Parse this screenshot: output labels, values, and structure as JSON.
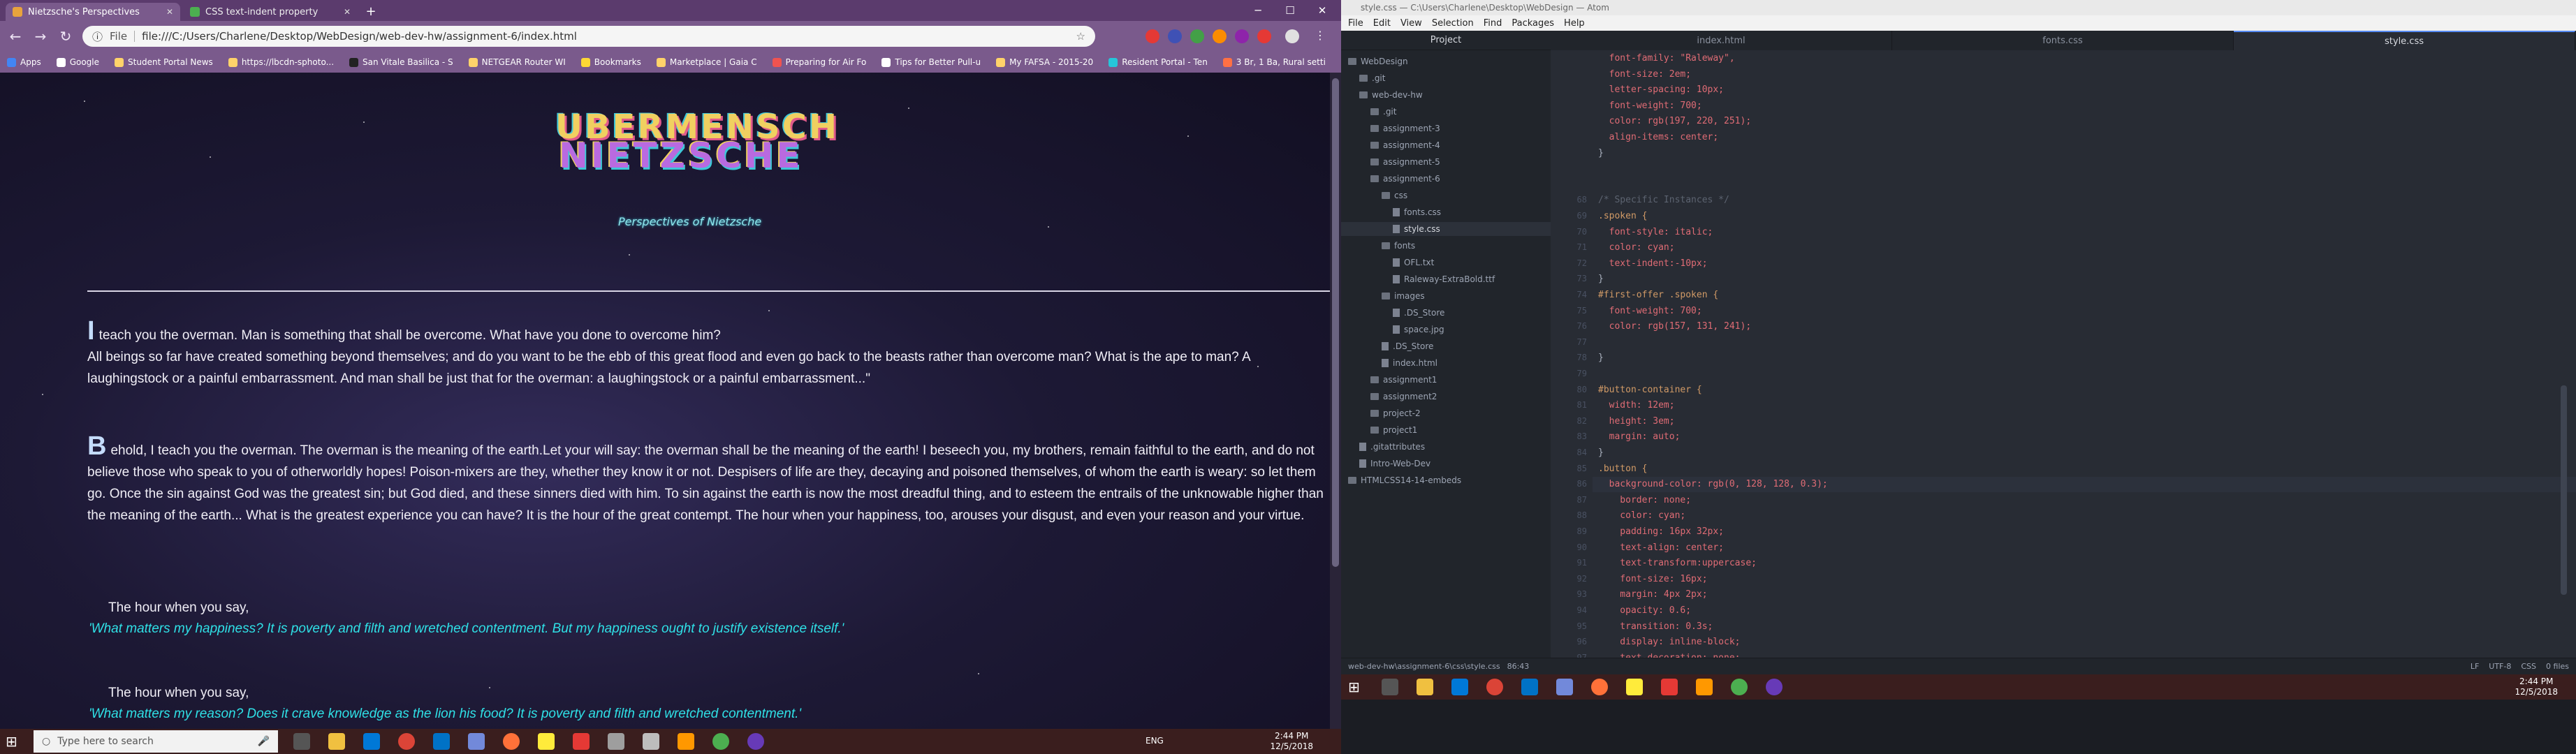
{
  "chrome": {
    "tabs": [
      {
        "label": "Nietzsche's Perspectives",
        "active": true
      },
      {
        "label": "CSS text-indent property",
        "active": false
      }
    ],
    "new_tab_icon": "plus-icon",
    "window_controls": [
      "minimize",
      "maximize",
      "close"
    ],
    "url_proto": "File",
    "url": "file:///C:/Users/Charlene/Desktop/WebDesign/web-dev-hw/assignment-6/index.html",
    "bookmarks": [
      "Apps",
      "Google",
      "Student Portal News",
      "https://lbcdn-sphoto...",
      "San Vitale Basilica - S",
      "NETGEAR Router WI",
      "Bookmarks",
      "Marketplace | Gaia C",
      "Preparing for Air Fo",
      "Tips for Better Pull-u",
      "My FAFSA - 2015-20",
      "Resident Portal - Ten",
      "3 Br, 1 Ba, Rural setti"
    ]
  },
  "page": {
    "title_line1": "UBERMENSCH",
    "title_line2": "NIETZSCHE",
    "subtitle": "Perspectives of Nietzsche",
    "p1_dropcap": "I",
    "p1_line1": "teach you the overman. Man is something that shall be overcome. What have you done to overcome him?",
    "p1_rest": "All beings so far have created something beyond themselves; and do you want to be the ebb of this great flood and even go back to the beasts rather than overcome man? What is the ape to man? A laughingstock or a painful embarrassment. And man shall be just that for the overman: a laughingstock or a painful embarrassment...\"",
    "p2_dropcap": "B",
    "p2_text": "ehold, I teach you the overman. The overman is the meaning of the earth.Let your will say: the overman shall be the meaning of the earth! I beseech you, my brothers, remain faithful to the earth, and do not believe those who speak to you of otherworldly hopes! Poison-mixers are they, whether they know it or not. Despisers of life are they, decaying and poisoned themselves, of whom the earth is weary: so let them go. Once the sin against God was the greatest sin; but God died, and these sinners died with him. To sin against the earth is now the most dreadful thing, and to esteem the entrails of the unknowable higher than the meaning of the earth... What is the greatest experience you can have? It is the hour of the great contempt. The hour when your happiness, too, arouses your disgust, and even your reason and your virtue.",
    "hour1": "The hour when you say,",
    "spoken1": "'What matters my happiness? It is poverty and filth and wretched contentment. But my happiness ought to justify existence itself.'",
    "hour2": "The hour when you say,",
    "spoken2": "'What matters my reason? Does it crave knowledge as the lion his food? It is poverty and filth and wretched contentment.'"
  },
  "taskbar_left": {
    "search_placeholder": "Type here to search",
    "time": "2:44 PM",
    "date": "12/5/2018",
    "lang": "ENG"
  },
  "atom": {
    "title": "style.css — C:\\Users\\Charlene\\Desktop\\WebDesign — Atom",
    "menu": [
      "File",
      "Edit",
      "View",
      "Selection",
      "Find",
      "Packages",
      "Help"
    ],
    "tree_header": "Project",
    "tree": [
      {
        "label": "WebDesign",
        "type": "folder",
        "depth": 0
      },
      {
        "label": ".git",
        "type": "folder",
        "depth": 1
      },
      {
        "label": "web-dev-hw",
        "type": "folder",
        "depth": 1
      },
      {
        "label": ".git",
        "type": "folder",
        "depth": 2
      },
      {
        "label": "assignment-3",
        "type": "folder",
        "depth": 2
      },
      {
        "label": "assignment-4",
        "type": "folder",
        "depth": 2
      },
      {
        "label": "assignment-5",
        "type": "folder",
        "depth": 2
      },
      {
        "label": "assignment-6",
        "type": "folder",
        "depth": 2
      },
      {
        "label": "css",
        "type": "folder",
        "depth": 3
      },
      {
        "label": "fonts.css",
        "type": "file",
        "depth": 4
      },
      {
        "label": "style.css",
        "type": "file",
        "depth": 4,
        "selected": true
      },
      {
        "label": "fonts",
        "type": "folder",
        "depth": 3
      },
      {
        "label": "OFL.txt",
        "type": "file",
        "depth": 4
      },
      {
        "label": "Raleway-ExtraBold.ttf",
        "type": "file",
        "depth": 4
      },
      {
        "label": "images",
        "type": "folder",
        "depth": 3
      },
      {
        "label": ".DS_Store",
        "type": "file",
        "depth": 4
      },
      {
        "label": "space.jpg",
        "type": "file",
        "depth": 4
      },
      {
        "label": ".DS_Store",
        "type": "file",
        "depth": 3
      },
      {
        "label": "index.html",
        "type": "file",
        "depth": 3
      },
      {
        "label": "assignment1",
        "type": "folder",
        "depth": 2
      },
      {
        "label": "assignment2",
        "type": "folder",
        "depth": 2
      },
      {
        "label": "project-2",
        "type": "folder",
        "depth": 2
      },
      {
        "label": "project1",
        "type": "folder",
        "depth": 2
      },
      {
        "label": ".gitattributes",
        "type": "file",
        "depth": 1
      },
      {
        "label": "Intro-Web-Dev",
        "type": "file",
        "depth": 1
      },
      {
        "label": "HTMLCSS14-14-embeds",
        "type": "folder",
        "depth": 0
      }
    ],
    "editor_tabs": [
      {
        "label": "index.html",
        "active": false
      },
      {
        "label": "fonts.css",
        "active": false
      },
      {
        "label": "style.css",
        "active": true
      }
    ],
    "lines": [
      {
        "n": "",
        "t": "  font-family: \"Raleway\","
      },
      {
        "n": "",
        "t": "  font-size: 2em;"
      },
      {
        "n": "",
        "t": "  letter-spacing: 10px;"
      },
      {
        "n": "",
        "t": "  font-weight: 700;"
      },
      {
        "n": "",
        "t": "  color: rgb(197, 220, 251);"
      },
      {
        "n": "",
        "t": "  align-items: center;"
      },
      {
        "n": "",
        "t": "}"
      },
      {
        "n": "",
        "t": ""
      },
      {
        "n": "",
        "t": ""
      },
      {
        "n": "68",
        "t": "/* Specific Instances */"
      },
      {
        "n": "69",
        "t": ".spoken {"
      },
      {
        "n": "70",
        "t": "  font-style: italic;"
      },
      {
        "n": "71",
        "t": "  color: cyan;"
      },
      {
        "n": "72",
        "t": "  text-indent:-10px;"
      },
      {
        "n": "73",
        "t": "}"
      },
      {
        "n": "74",
        "t": "#first-offer .spoken {"
      },
      {
        "n": "75",
        "t": "  font-weight: 700;"
      },
      {
        "n": "76",
        "t": "  color: rgb(157, 131, 241);"
      },
      {
        "n": "77",
        "t": ""
      },
      {
        "n": "78",
        "t": "}"
      },
      {
        "n": "79",
        "t": ""
      },
      {
        "n": "80",
        "t": "#button-container {"
      },
      {
        "n": "81",
        "t": "  width: 12em;"
      },
      {
        "n": "82",
        "t": "  height: 3em;"
      },
      {
        "n": "83",
        "t": "  margin: auto;"
      },
      {
        "n": "84",
        "t": "}"
      },
      {
        "n": "85",
        "t": ".button {"
      },
      {
        "n": "86",
        "t": "  background-color: rgb(0, 128, 128, 0.3);"
      },
      {
        "n": "87",
        "t": "    border: none;"
      },
      {
        "n": "88",
        "t": "    color: cyan;"
      },
      {
        "n": "89",
        "t": "    padding: 16px 32px;"
      },
      {
        "n": "90",
        "t": "    text-align: center;"
      },
      {
        "n": "91",
        "t": "    text-transform:uppercase;"
      },
      {
        "n": "92",
        "t": "    font-size: 16px;"
      },
      {
        "n": "93",
        "t": "    margin: 4px 2px;"
      },
      {
        "n": "94",
        "t": "    opacity: 0.6;"
      },
      {
        "n": "95",
        "t": "    transition: 0.3s;"
      },
      {
        "n": "96",
        "t": "    display: inline-block;"
      },
      {
        "n": "97",
        "t": "    text-decoration: none;"
      }
    ],
    "status_path": "web-dev-hw\\assignment-6\\css\\style.css",
    "status_pos": "86:43",
    "status_right": [
      "LF",
      "UTF-8",
      "CSS",
      "0 files"
    ],
    "time": "2:44 PM",
    "date": "12/5/2018"
  }
}
